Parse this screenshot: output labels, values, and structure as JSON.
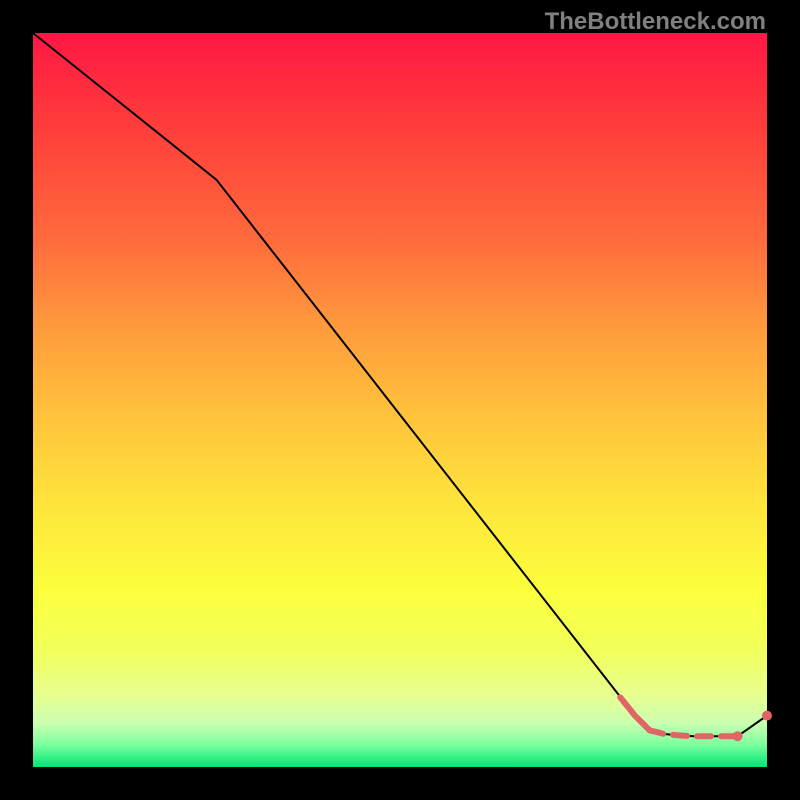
{
  "watermark": "TheBottleneck.com",
  "chart_data": {
    "type": "line",
    "title": "",
    "xlabel": "",
    "ylabel": "",
    "xlim": [
      0,
      100
    ],
    "ylim": [
      0,
      100
    ],
    "grid": false,
    "legend": false,
    "series": [
      {
        "name": "main-curve",
        "color": "#000000",
        "stroke_width": 2,
        "x": [
          0,
          25,
          82,
          84,
          86,
          88,
          90,
          92,
          94,
          96,
          100
        ],
        "y": [
          100,
          80,
          7,
          5,
          4.5,
          4.3,
          4.2,
          4.2,
          4.2,
          4.2,
          7
        ]
      },
      {
        "name": "highlight-segment",
        "color": "#e06666",
        "stroke_width": 6,
        "dashed_tail": true,
        "x": [
          80,
          82,
          84,
          86,
          88,
          90,
          92,
          94,
          96
        ],
        "y": [
          9.5,
          7,
          5,
          4.5,
          4.3,
          4.2,
          4.2,
          4.2,
          4.2
        ]
      }
    ],
    "points": [
      {
        "x": 96,
        "y": 4.2,
        "color": "#e06666",
        "r": 5
      },
      {
        "x": 100,
        "y": 7,
        "color": "#e06666",
        "r": 5
      }
    ]
  }
}
